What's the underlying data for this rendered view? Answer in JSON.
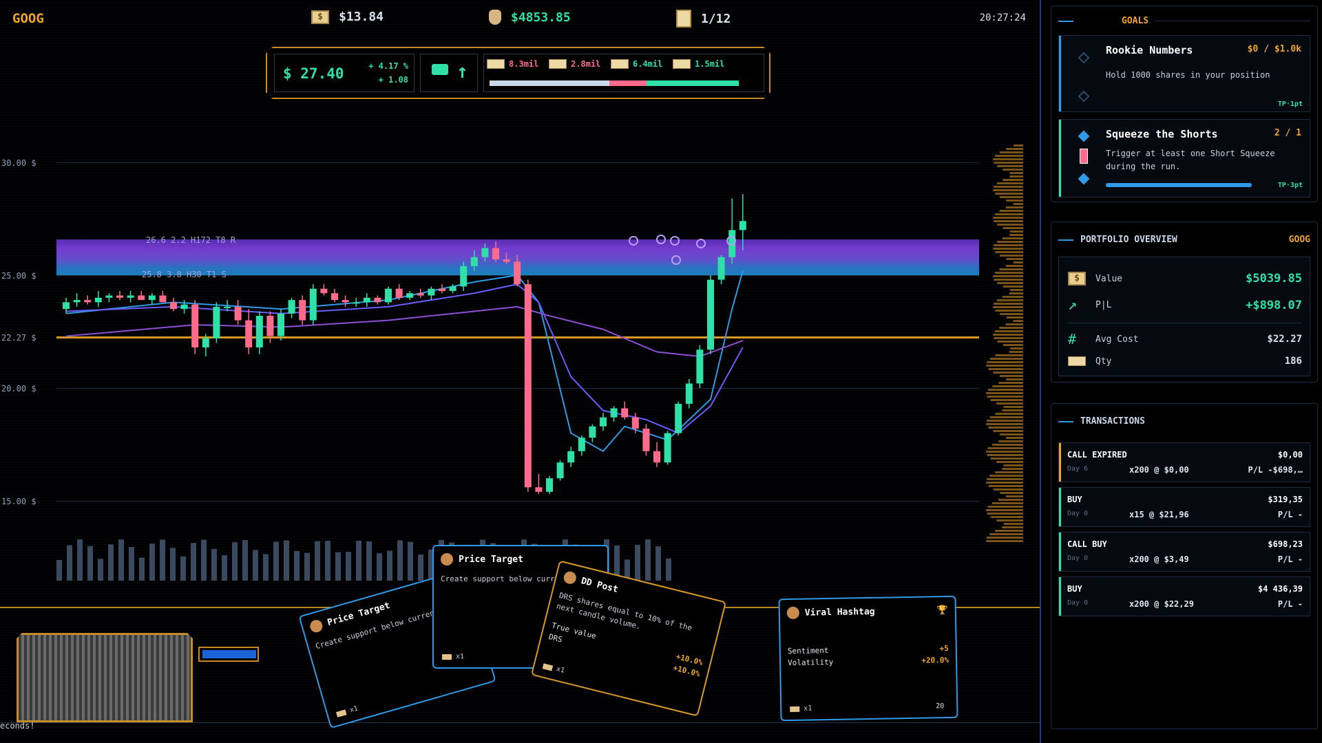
{
  "top_bar": {
    "ticker": "GOOG",
    "cash": "$13.84",
    "bag_value": "$4853.85",
    "day_progress": "1/12",
    "clock": "20:27:24"
  },
  "price_panel": {
    "price": "$ 27.40",
    "pct_change": "+ 4.17 %",
    "abs_change": "+ 1.08",
    "volumes": [
      {
        "label": "8.3mil",
        "color": "#ff6b8a"
      },
      {
        "label": "2.8mil",
        "color": "#ff6b8a"
      },
      {
        "label": "6.4mil",
        "color": "#2fe0a8"
      },
      {
        "label": "1.5mil",
        "color": "#2fe0a8"
      }
    ],
    "volume_split": [
      0.48,
      0.15,
      0.37
    ]
  },
  "chart": {
    "y_labels": [
      "30.00 $",
      "25.00 $",
      "22.27 $",
      "20.00 $",
      "15.00 $"
    ],
    "band_labels": [
      "26.6 2.2 H172 T8 R",
      "25.8 3.8 H30 T1 S"
    ]
  },
  "chart_data": {
    "type": "candlestick",
    "ylim": [
      15,
      30
    ],
    "support_level": 22.27,
    "candles": [
      [
        23.5,
        24.0,
        23.3,
        23.8
      ],
      [
        23.8,
        24.2,
        23.6,
        23.9
      ],
      [
        23.9,
        24.1,
        23.7,
        23.8
      ],
      [
        23.8,
        24.3,
        23.6,
        24.0
      ],
      [
        24.0,
        24.2,
        23.8,
        24.1
      ],
      [
        24.1,
        24.3,
        23.9,
        24.0
      ],
      [
        24.0,
        24.3,
        23.8,
        24.1
      ],
      [
        24.1,
        24.3,
        23.9,
        23.9
      ],
      [
        23.9,
        24.2,
        23.7,
        24.1
      ],
      [
        24.1,
        24.3,
        23.9,
        23.8
      ],
      [
        23.8,
        24.0,
        23.4,
        23.5
      ],
      [
        23.5,
        23.9,
        23.3,
        23.7
      ],
      [
        23.7,
        23.9,
        21.5,
        21.8
      ],
      [
        21.8,
        22.4,
        21.4,
        22.2
      ],
      [
        22.2,
        23.8,
        22.0,
        23.6
      ],
      [
        23.6,
        23.9,
        23.4,
        23.6
      ],
      [
        23.6,
        23.9,
        22.8,
        23.0
      ],
      [
        23.0,
        23.5,
        21.5,
        21.8
      ],
      [
        21.8,
        23.4,
        21.5,
        23.2
      ],
      [
        23.2,
        23.4,
        22.0,
        22.3
      ],
      [
        22.3,
        23.5,
        22.1,
        23.3
      ],
      [
        23.3,
        24.0,
        23.1,
        23.9
      ],
      [
        23.9,
        24.1,
        22.8,
        23.0
      ],
      [
        23.0,
        24.6,
        22.8,
        24.4
      ],
      [
        24.4,
        24.6,
        24.1,
        24.2
      ],
      [
        24.2,
        24.4,
        23.8,
        23.9
      ],
      [
        23.9,
        24.1,
        23.6,
        23.8
      ],
      [
        23.8,
        24.0,
        23.6,
        23.8
      ],
      [
        23.8,
        24.2,
        23.6,
        24.0
      ],
      [
        24.0,
        24.1,
        23.7,
        23.8
      ],
      [
        23.8,
        24.5,
        23.7,
        24.4
      ],
      [
        24.4,
        24.6,
        23.9,
        24.0
      ],
      [
        24.0,
        24.3,
        23.9,
        24.2
      ],
      [
        24.2,
        24.4,
        24.0,
        24.1
      ],
      [
        24.1,
        24.5,
        23.9,
        24.4
      ],
      [
        24.4,
        24.6,
        24.2,
        24.3
      ],
      [
        24.3,
        24.6,
        24.2,
        24.5
      ],
      [
        24.5,
        25.6,
        24.3,
        25.4
      ],
      [
        25.4,
        26.1,
        25.2,
        25.8
      ],
      [
        25.8,
        26.4,
        25.6,
        26.2
      ],
      [
        26.2,
        26.5,
        25.6,
        25.7
      ],
      [
        25.7,
        26.0,
        25.5,
        25.6
      ],
      [
        25.6,
        25.9,
        24.5,
        24.6
      ],
      [
        24.6,
        24.8,
        15.4,
        15.6
      ],
      [
        15.6,
        16.2,
        15.3,
        15.4
      ],
      [
        15.4,
        16.1,
        15.3,
        16.0
      ],
      [
        16.0,
        16.8,
        15.9,
        16.7
      ],
      [
        16.7,
        17.4,
        16.5,
        17.2
      ],
      [
        17.2,
        17.9,
        17.0,
        17.8
      ],
      [
        17.8,
        18.4,
        17.6,
        18.3
      ],
      [
        18.3,
        18.9,
        18.1,
        18.7
      ],
      [
        18.7,
        19.2,
        18.5,
        19.1
      ],
      [
        19.1,
        19.4,
        18.6,
        18.7
      ],
      [
        18.7,
        18.9,
        18.0,
        18.2
      ],
      [
        18.2,
        18.4,
        17.0,
        17.2
      ],
      [
        17.2,
        17.6,
        16.5,
        16.7
      ],
      [
        16.7,
        18.1,
        16.6,
        18.0
      ],
      [
        18.0,
        19.4,
        17.9,
        19.3
      ],
      [
        19.3,
        20.4,
        19.1,
        20.2
      ],
      [
        20.2,
        21.9,
        20.0,
        21.7
      ],
      [
        21.7,
        25.0,
        21.5,
        24.8
      ],
      [
        24.8,
        25.9,
        24.6,
        25.8
      ],
      [
        25.8,
        28.4,
        25.5,
        27.0
      ],
      [
        27.0,
        28.6,
        26.1,
        27.4
      ]
    ],
    "moving_averages": [
      {
        "color": "#2f9be8",
        "points": [
          [
            0,
            23.3
          ],
          [
            10,
            23.8
          ],
          [
            20,
            23.5
          ],
          [
            30,
            23.9
          ],
          [
            38,
            24.7
          ],
          [
            42,
            25.0
          ],
          [
            44,
            23.8
          ],
          [
            47,
            18.0
          ],
          [
            50,
            17.2
          ],
          [
            52,
            18.3
          ],
          [
            56,
            17.7
          ],
          [
            60,
            19.5
          ],
          [
            62,
            23.5
          ],
          [
            63,
            25.2
          ]
        ]
      },
      {
        "color": "#6a5cff",
        "points": [
          [
            0,
            23.4
          ],
          [
            10,
            23.6
          ],
          [
            20,
            23.3
          ],
          [
            30,
            23.6
          ],
          [
            38,
            24.2
          ],
          [
            42,
            24.6
          ],
          [
            44,
            23.8
          ],
          [
            47,
            20.5
          ],
          [
            50,
            19.0
          ],
          [
            54,
            18.6
          ],
          [
            57,
            18.0
          ],
          [
            60,
            19.2
          ],
          [
            63,
            21.8
          ]
        ]
      },
      {
        "color": "#8e4fd8",
        "points": [
          [
            0,
            22.3
          ],
          [
            12,
            22.8
          ],
          [
            20,
            22.7
          ],
          [
            30,
            23.0
          ],
          [
            38,
            23.4
          ],
          [
            42,
            23.6
          ],
          [
            45,
            23.2
          ],
          [
            50,
            22.6
          ],
          [
            55,
            21.6
          ],
          [
            59,
            21.4
          ],
          [
            63,
            22.1
          ]
        ]
      }
    ]
  },
  "cards": [
    {
      "title": "Price Target",
      "desc": "Create support below curren",
      "count": "x1"
    },
    {
      "title": "Price Target",
      "desc": "Create support below curren",
      "count": "x1"
    },
    {
      "title": "DD Post",
      "desc": "DRS shares equal to 10% of the next candle volume.",
      "effect1": "True value",
      "effect2": "DRS",
      "v1": "+10.0%",
      "v2": "+10.0%",
      "count": "x1"
    },
    {
      "title": "Viral Hashtag",
      "effect1": "Sentiment",
      "effect2": "Volatility",
      "v1": "+5",
      "v2": "+20.0%",
      "count": "x1",
      "cost": "20"
    }
  ],
  "status_message": "econds!",
  "goals": {
    "heading": "GOALS",
    "items": [
      {
        "title": "Rookie Numbers",
        "progress": "$0 / $1.0k",
        "desc": "Hold 1000 shares in your position",
        "reward": "TP·1pt",
        "rail": "#2f9be8"
      },
      {
        "title": "Squeeze the Shorts",
        "progress": "2 / 1",
        "desc": "Trigger at least one Short Squeeze during the run.",
        "reward": "TP·3pt",
        "rail": "#2fe0a8",
        "bar": 1.0
      }
    ]
  },
  "portfolio": {
    "heading": "PORTFOLIO OVERVIEW",
    "ticker": "GOOG",
    "value_label": "Value",
    "value": "$5039.85",
    "pl_label": "P|L",
    "pl": "+$898.07",
    "avg_label": "Avg Cost",
    "avg": "$22.27",
    "qty_label": "Qty",
    "qty": "186"
  },
  "transactions": {
    "heading": "TRANSACTIONS",
    "items": [
      {
        "type": "CALL EXPIRED",
        "total": "$0,00",
        "day": "Day 6",
        "qty": "x200  @  $0,00",
        "pl": "P/L -$698,…",
        "rail": "#f0a52a"
      },
      {
        "type": "BUY",
        "total": "$319,35",
        "day": "Day 0",
        "qty": "x15  @  $21,96",
        "pl": "P/L -",
        "rail": "#2fe0a8"
      },
      {
        "type": "CALL BUY",
        "total": "$698,23",
        "day": "Day 0",
        "qty": "x200  @  $3,49",
        "pl": "P/L -",
        "rail": "#2fe0a8"
      },
      {
        "type": "BUY",
        "total": "$4 436,39",
        "day": "Day 0",
        "qty": "x200  @  $22,29",
        "pl": "P/L -",
        "rail": "#2fe0a8"
      }
    ]
  },
  "colors": {
    "accent": "#f0a52a",
    "up": "#2fe0a8",
    "down": "#ff6b8a",
    "blue": "#2f9be8"
  }
}
